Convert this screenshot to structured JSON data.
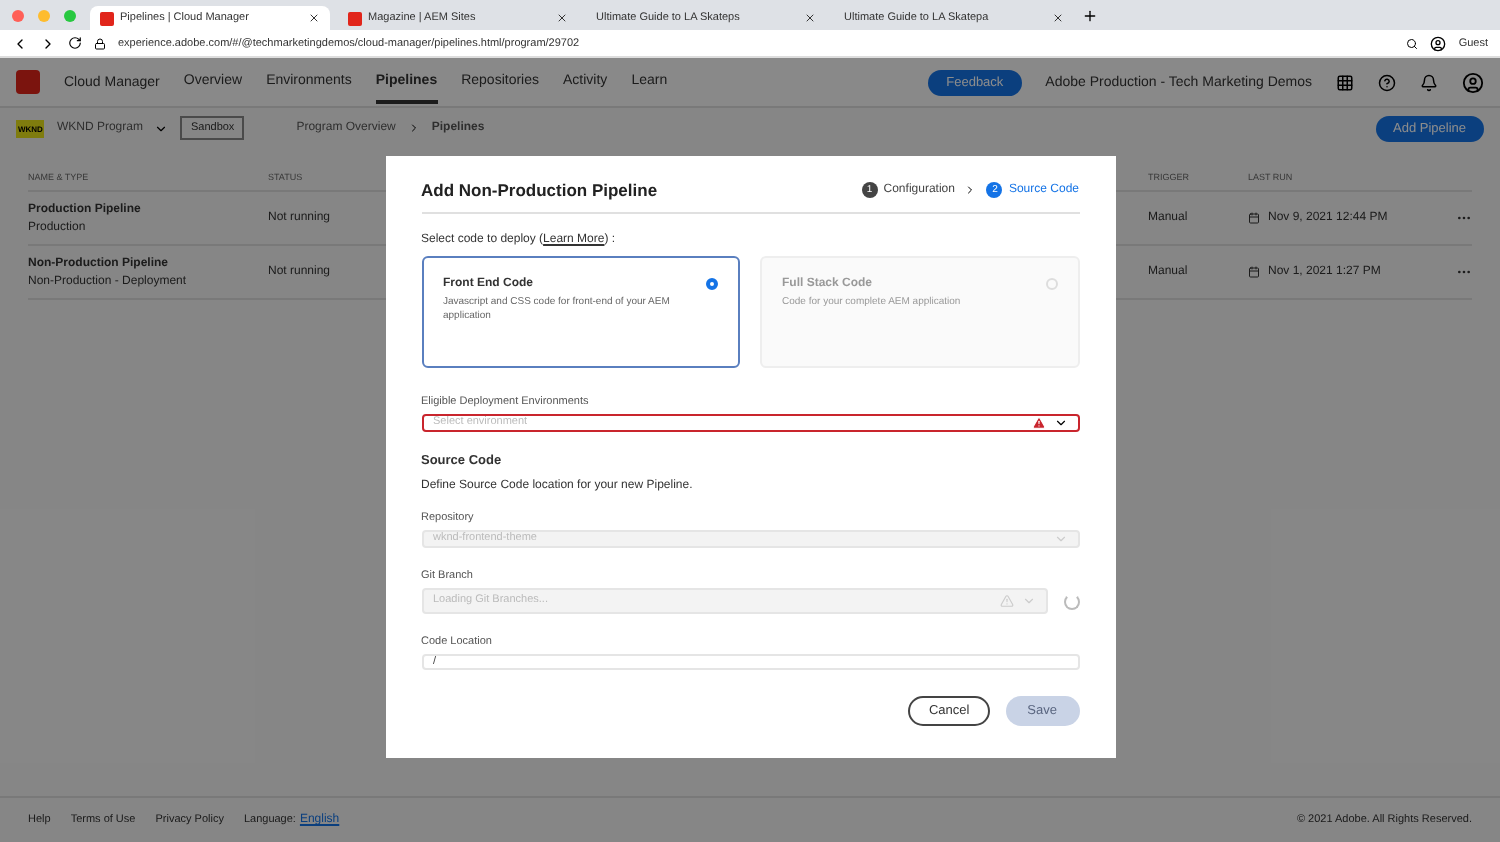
{
  "browser": {
    "tabs": [
      {
        "title": "Pipelines | Cloud Manager",
        "selected": true,
        "kind": "adobe"
      },
      {
        "title": "Magazine | AEM Sites",
        "selected": false,
        "kind": "adobe"
      },
      {
        "title": "Ultimate Guide to LA Skateps",
        "selected": false,
        "kind": "plain"
      },
      {
        "title": "Ultimate Guide to LA Skatepa",
        "selected": false,
        "kind": "plain"
      }
    ],
    "url": "experience.adobe.com/#/@techmarketingdemos/cloud-manager/pipelines.html/program/29702",
    "profile": "Guest"
  },
  "header": {
    "brand": "Cloud Manager",
    "nav": [
      {
        "label": "Overview",
        "selected": false
      },
      {
        "label": "Environments",
        "selected": false
      },
      {
        "label": "Pipelines",
        "selected": true
      },
      {
        "label": "Repositories",
        "selected": false
      },
      {
        "label": "Activity",
        "selected": false
      },
      {
        "label": "Learn",
        "selected": false
      }
    ],
    "feedback": "Feedback",
    "org": "Adobe Production - Tech Marketing Demos"
  },
  "subbar": {
    "program_badge": "WKND",
    "program": "WKND Program",
    "sandbox": "Sandbox",
    "breadcrumbs": [
      "Program Overview",
      "Pipelines"
    ],
    "add": "Add Pipeline"
  },
  "table": {
    "columns": [
      "NAME & TYPE",
      "STATUS",
      "TRIGGER",
      "LAST RUN"
    ],
    "rows": [
      {
        "name": "Production Pipeline",
        "type": "Production",
        "status": "Not running",
        "trigger": "Manual",
        "last_run": "Nov 9, 2021 12:44 PM"
      },
      {
        "name": "Non-Production Pipeline",
        "type": "Non-Production - Deployment",
        "status": "Not running",
        "trigger": "Manual",
        "last_run": "Nov 1, 2021 1:27 PM"
      }
    ]
  },
  "footer": {
    "links": [
      "Help",
      "Terms of Use",
      "Privacy Policy"
    ],
    "language_label": "Language:",
    "language": "English",
    "copyright": "© 2021 Adobe. All Rights Reserved."
  },
  "modal": {
    "title": "Add Non-Production Pipeline",
    "steps": [
      {
        "number": "1",
        "label": "Configuration",
        "selected": false
      },
      {
        "number": "2",
        "label": "Source Code",
        "selected": true
      }
    ],
    "prompt": [
      "Select code to deploy (",
      ") :"
    ],
    "learn_more": "Learn More",
    "options": [
      {
        "title": "Front End Code",
        "description": "Javascript and CSS code for front-end of your AEM application",
        "selected": true,
        "disabled": false
      },
      {
        "title": "Full Stack Code",
        "description": "Code for your complete AEM application",
        "selected": false,
        "disabled": true
      }
    ],
    "environment": {
      "label": "Eligible Deployment Environments",
      "placeholder": "Select environment",
      "error": true
    },
    "section_title": "Source Code",
    "section_desc": "Define Source Code location for your new Pipeline.",
    "repository": {
      "label": "Repository",
      "value": "wknd-frontend-theme",
      "disabled": true
    },
    "branch": {
      "label": "Git Branch",
      "placeholder": "Loading Git Branches...",
      "loading": true
    },
    "location": {
      "label": "Code Location",
      "value": "/"
    },
    "cancel": "Cancel",
    "save": "Save"
  }
}
